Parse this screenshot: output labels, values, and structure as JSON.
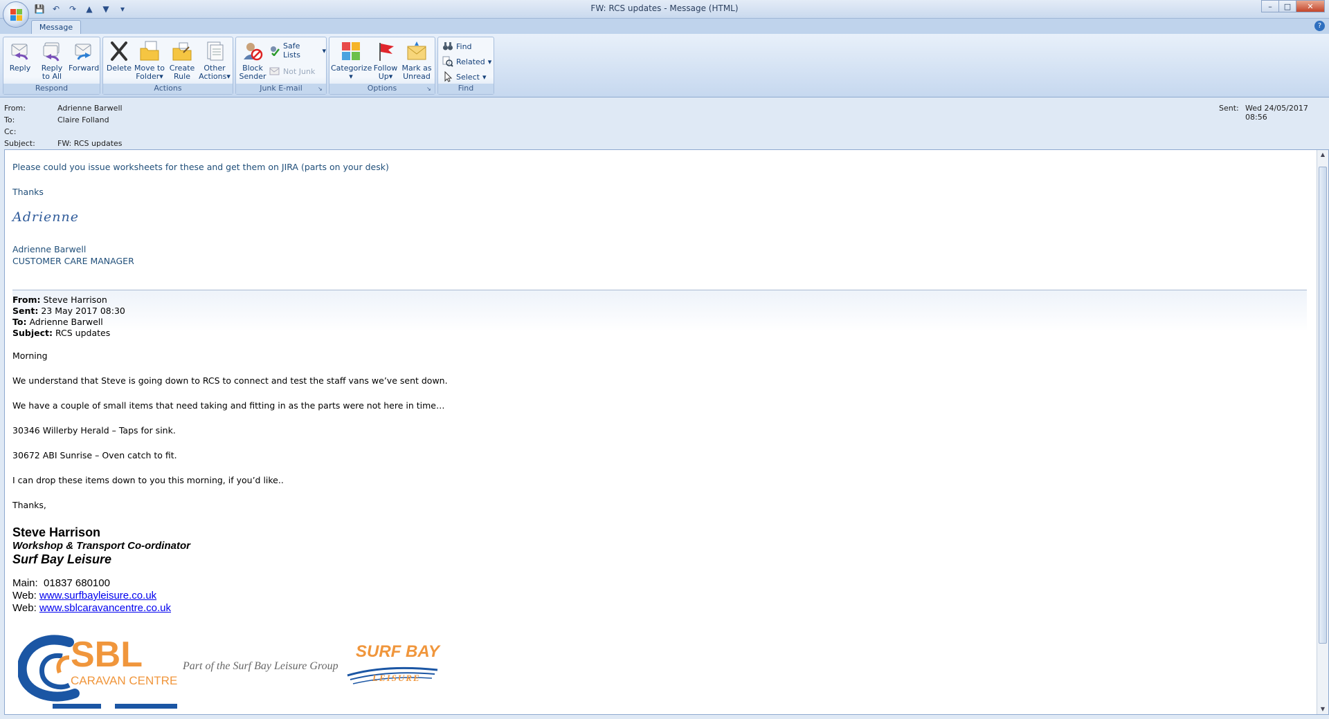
{
  "window": {
    "title": "FW: RCS updates - Message (HTML)"
  },
  "tabs": [
    {
      "label": "Message"
    }
  ],
  "ribbon": {
    "respond": {
      "label": "Respond",
      "reply": "Reply",
      "reply_all_1": "Reply",
      "reply_all_2": "to All",
      "forward": "Forward"
    },
    "actions": {
      "label": "Actions",
      "delete": "Delete",
      "move_1": "Move to",
      "move_2": "Folder",
      "create_1": "Create",
      "create_2": "Rule",
      "other_1": "Other",
      "other_2": "Actions"
    },
    "junk": {
      "label": "Junk E-mail",
      "block_1": "Block",
      "block_2": "Sender",
      "safe_lists": "Safe Lists",
      "not_junk": "Not Junk"
    },
    "options": {
      "label": "Options",
      "categorize": "Categorize",
      "follow_1": "Follow",
      "follow_2": "Up",
      "mark_1": "Mark as",
      "mark_2": "Unread"
    },
    "find": {
      "label": "Find",
      "find": "Find",
      "related": "Related",
      "select": "Select"
    }
  },
  "header": {
    "from_label": "From:",
    "from": "Adrienne Barwell",
    "to_label": "To:",
    "to": "Claire Folland",
    "cc_label": "Cc:",
    "cc": "",
    "subject_label": "Subject:",
    "subject": "FW: RCS updates",
    "sent_label": "Sent:",
    "sent": "Wed 24/05/2017 08:56"
  },
  "message": {
    "request": "Please could you issue worksheets for these and get them on JIRA (parts on  your desk)",
    "thanks": "Thanks",
    "handwritten_signature": "Adrienne",
    "sender_name": "Adrienne Barwell",
    "sender_title": "CUSTOMER CARE MANAGER",
    "fwd_from_label": "From:",
    "fwd_from": "Steve Harrison",
    "fwd_sent_label": "Sent:",
    "fwd_sent": "23 May 2017 08:30",
    "fwd_to_label": "To:",
    "fwd_to": "Adrienne Barwell",
    "fwd_subject_label": "Subject:",
    "fwd_subject": "RCS updates",
    "line1": "Morning",
    "line2": "We understand that Steve is going down to RCS to connect and test the staff vans we’ve sent down.",
    "line3": "We have a couple of small items that need taking and fitting in as the parts were not here in time…",
    "line4": "30346 Willerby Herald – Taps for sink.",
    "line5": "30672 ABI Sunrise – Oven catch to fit.",
    "line6": "I can drop these items down to you this morning, if you’d like..",
    "line7": "Thanks,",
    "sig_name": "Steve Harrison",
    "sig_role": "Workshop & Transport Co-ordinator",
    "sig_company": "Surf Bay Leisure",
    "main_label": "Main:",
    "main_phone": "01837 680100",
    "web_label_1": "Web:",
    "web_1": "www.surfbayleisure.co.uk",
    "web_label_2": "Web:",
    "web_2": "www.sblcaravancentre.co.uk",
    "logo_sbl": "SBL",
    "logo_sbl_sub": "CARAVAN CENTRE",
    "logo_group": "Part of the Surf Bay Leisure Group",
    "logo_surfbay": "SURF BAY",
    "logo_surfbay_sub": "LEISURE"
  },
  "colors": {
    "ribbon_text": "#15417a",
    "body_blue": "#1f4e79",
    "sbl_orange": "#f0963c",
    "sbl_blue": "#1b56a4"
  }
}
